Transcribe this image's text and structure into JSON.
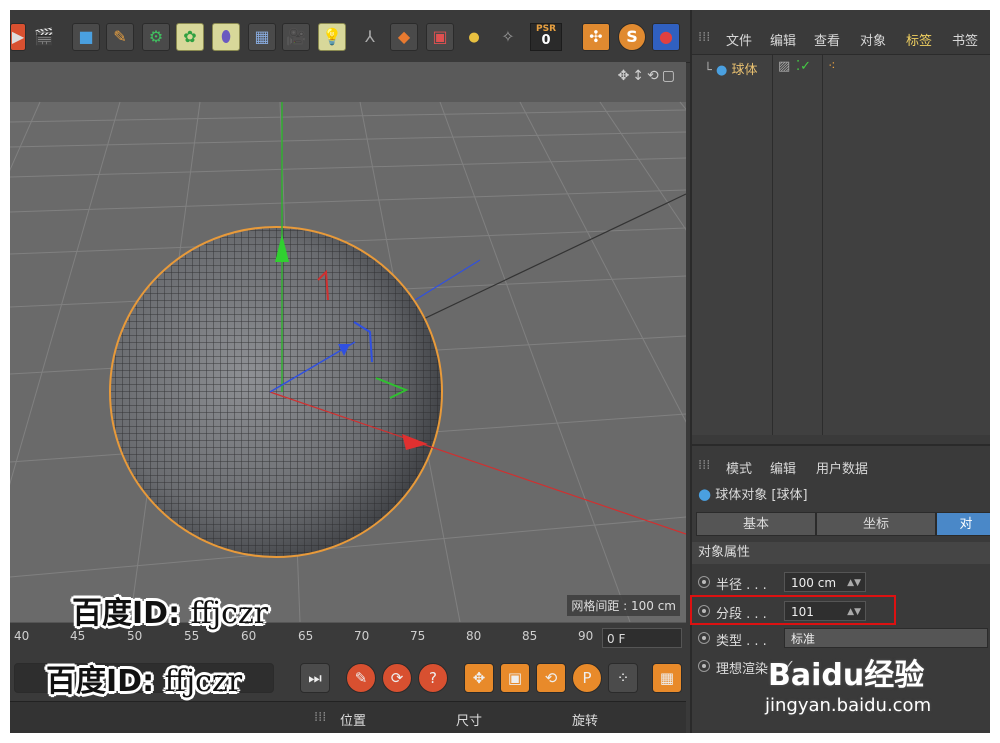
{
  "toolbar": {
    "psr_label": "PSR",
    "psr_value": "0",
    "icons": [
      "clapper-icon",
      "cube-icon",
      "pen-icon",
      "cog-object-icon",
      "sphere-gen-icon",
      "deformer-icon",
      "floor-icon",
      "camera-icon",
      "light-icon",
      "bone-icon",
      "material-icon",
      "render-icon",
      "xyz-icon",
      "snap-icon",
      "s-icon",
      "scene-icon"
    ]
  },
  "viewport": {
    "grid_spacing_label": "网格间距 : 100 cm"
  },
  "timeline": {
    "ticks": [
      "40",
      "45",
      "50",
      "55",
      "60",
      "65",
      "70",
      "75",
      "80",
      "85",
      "90"
    ],
    "current_frame": "0 F"
  },
  "coord_bar": {
    "position": "位置",
    "size": "尺寸",
    "rotation": "旋转"
  },
  "object_manager": {
    "menu": [
      "文件",
      "编辑",
      "查看",
      "对象",
      "标签",
      "书签"
    ],
    "object_name": "球体"
  },
  "attribute_manager": {
    "menu": [
      "模式",
      "编辑",
      "用户数据"
    ],
    "title": "球体对象 [球体]",
    "tabs": [
      "基本",
      "坐标",
      "对"
    ],
    "section": "对象属性",
    "radius_label": "半径 . . .",
    "radius_value": "100 cm",
    "segments_label": "分段 . . .",
    "segments_value": "101",
    "type_label": "类型 . . .",
    "type_value": "标准",
    "render_label": "理想渲染"
  },
  "watermark": {
    "line1_prefix": "百度ID:",
    "line1_id": "ffjczr",
    "line2_prefix": "百度ID:",
    "line2_id": "ffjczr",
    "baidu_logo": "Baidu经验",
    "baidu_url": "jingyan.baidu.com"
  },
  "colors": {
    "highlight": "#dd1111",
    "active_tab": "#4a88c8",
    "selection_outline": "#e89a3a"
  }
}
